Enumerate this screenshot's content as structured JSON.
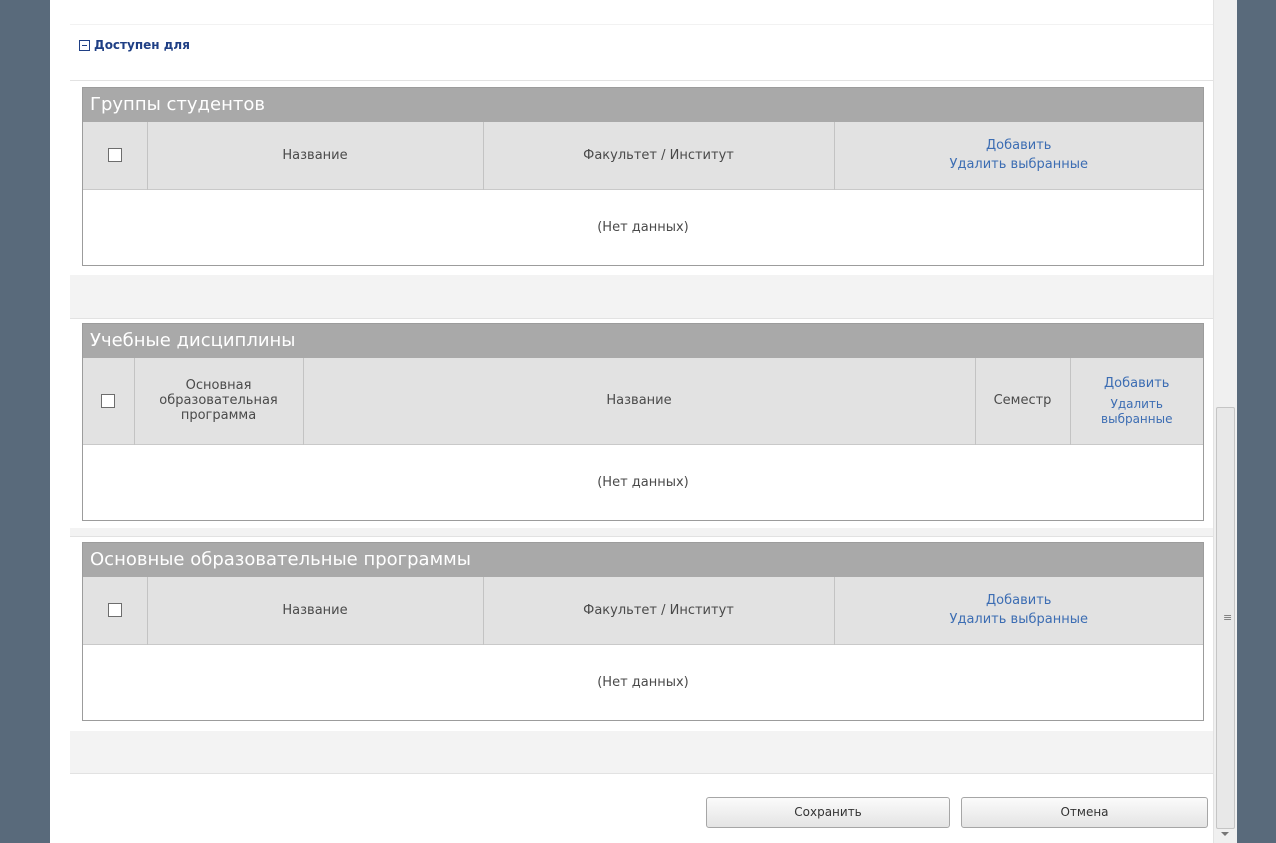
{
  "section": {
    "toggle_label": "Доступен для"
  },
  "groups_panel": {
    "title": "Группы студентов",
    "col_name": "Название",
    "col_faculty": "Факультет / Институт",
    "add_link": "Добавить",
    "delete_link": "Удалить выбранные",
    "empty_text": "(Нет данных)"
  },
  "disciplines_panel": {
    "title": "Учебные дисциплины",
    "col_program": "Основная образовательная программа",
    "col_name": "Название",
    "col_semester": "Семестр",
    "add_link": "Добавить",
    "delete_link": "Удалить выбранные",
    "empty_text": "(Нет данных)"
  },
  "programs_panel": {
    "title": "Основные образовательные программы",
    "col_name": "Название",
    "col_faculty": "Факультет / Институт",
    "add_link": "Добавить",
    "delete_link": "Удалить выбранные",
    "empty_text": "(Нет данных)"
  },
  "buttons": {
    "save_label": "Сохранить",
    "cancel_label": "Отмена"
  },
  "scrollbar": {
    "grip_glyph": "≡"
  }
}
